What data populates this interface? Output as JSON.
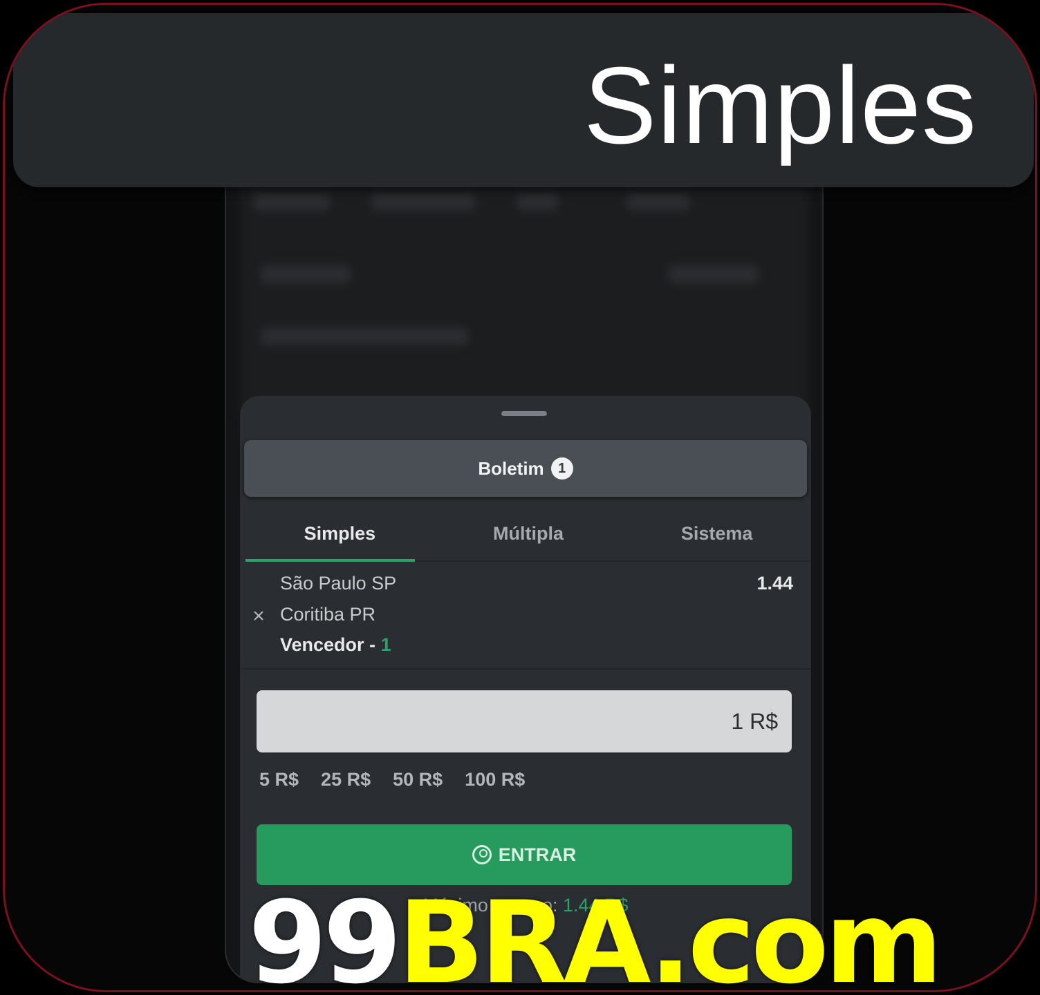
{
  "header": {
    "title": "Simples"
  },
  "sheet": {
    "boletim_label": "Boletim",
    "boletim_count": "1",
    "tabs": [
      {
        "label": "Simples",
        "active": true
      },
      {
        "label": "Múltipla",
        "active": false
      },
      {
        "label": "Sistema",
        "active": false
      }
    ],
    "bet": {
      "team_home": "São Paulo SP",
      "team_away": "Coritiba PR",
      "market": "Vencedor -",
      "selection": "1",
      "odd": "1.44",
      "remove_icon": "close-icon"
    },
    "stake_value": "1 R$",
    "quick_stakes": [
      "5 R$",
      "25 R$",
      "50 R$",
      "100 R$"
    ],
    "enter_label": "ENTRAR",
    "enter_icon": "user-circle-icon",
    "max_return_label": "Máximo retorno:",
    "max_return_value": "1.44 R$"
  },
  "brand": {
    "part1": "99",
    "part2": "BRA.com"
  },
  "colors": {
    "accent_green": "#279a5d",
    "frame_border": "#7a1020",
    "brand_yellow": "#ffff00"
  }
}
